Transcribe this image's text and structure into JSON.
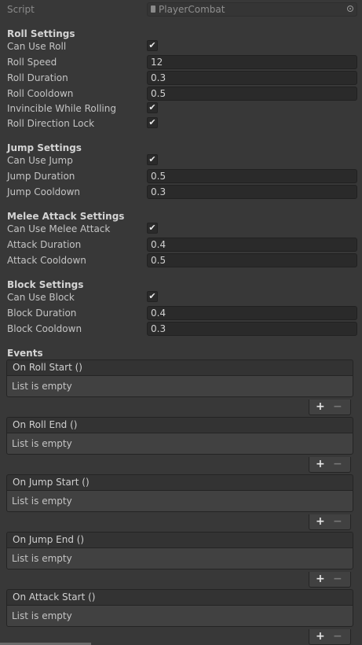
{
  "script": {
    "label": "Script",
    "value": "PlayerCombat"
  },
  "sections": [
    {
      "header": "Roll Settings",
      "fields": [
        {
          "label": "Can Use Roll",
          "type": "check",
          "checked": true
        },
        {
          "label": "Roll Speed",
          "type": "text",
          "value": "12"
        },
        {
          "label": "Roll Duration",
          "type": "text",
          "value": "0.3"
        },
        {
          "label": "Roll Cooldown",
          "type": "text",
          "value": "0.5"
        },
        {
          "label": "Invincible While Rolling",
          "type": "check",
          "checked": true
        },
        {
          "label": "Roll Direction Lock",
          "type": "check",
          "checked": true
        }
      ]
    },
    {
      "header": "Jump Settings",
      "fields": [
        {
          "label": "Can Use Jump",
          "type": "check",
          "checked": true
        },
        {
          "label": "Jump Duration",
          "type": "text",
          "value": "0.5"
        },
        {
          "label": "Jump Cooldown",
          "type": "text",
          "value": "0.3"
        }
      ]
    },
    {
      "header": "Melee Attack Settings",
      "fields": [
        {
          "label": "Can Use Melee Attack",
          "type": "check",
          "checked": true
        },
        {
          "label": "Attack Duration",
          "type": "text",
          "value": "0.4"
        },
        {
          "label": "Attack Cooldown",
          "type": "text",
          "value": "0.5"
        }
      ]
    },
    {
      "header": "Block Settings",
      "fields": [
        {
          "label": "Can Use Block",
          "type": "check",
          "checked": true
        },
        {
          "label": "Block Duration",
          "type": "text",
          "value": "0.4"
        },
        {
          "label": "Block Cooldown",
          "type": "text",
          "value": "0.3"
        }
      ]
    }
  ],
  "events": {
    "header": "Events",
    "items": [
      {
        "name": "On Roll Start ()",
        "empty_text": "List is empty"
      },
      {
        "name": "On Roll End ()",
        "empty_text": "List is empty"
      },
      {
        "name": "On Jump Start ()",
        "empty_text": "List is empty"
      },
      {
        "name": "On Jump End ()",
        "empty_text": "List is empty"
      },
      {
        "name": "On Attack Start ()",
        "empty_text": "List is empty"
      }
    ],
    "add_label": "+",
    "remove_label": "−"
  },
  "checkmark": "✔"
}
